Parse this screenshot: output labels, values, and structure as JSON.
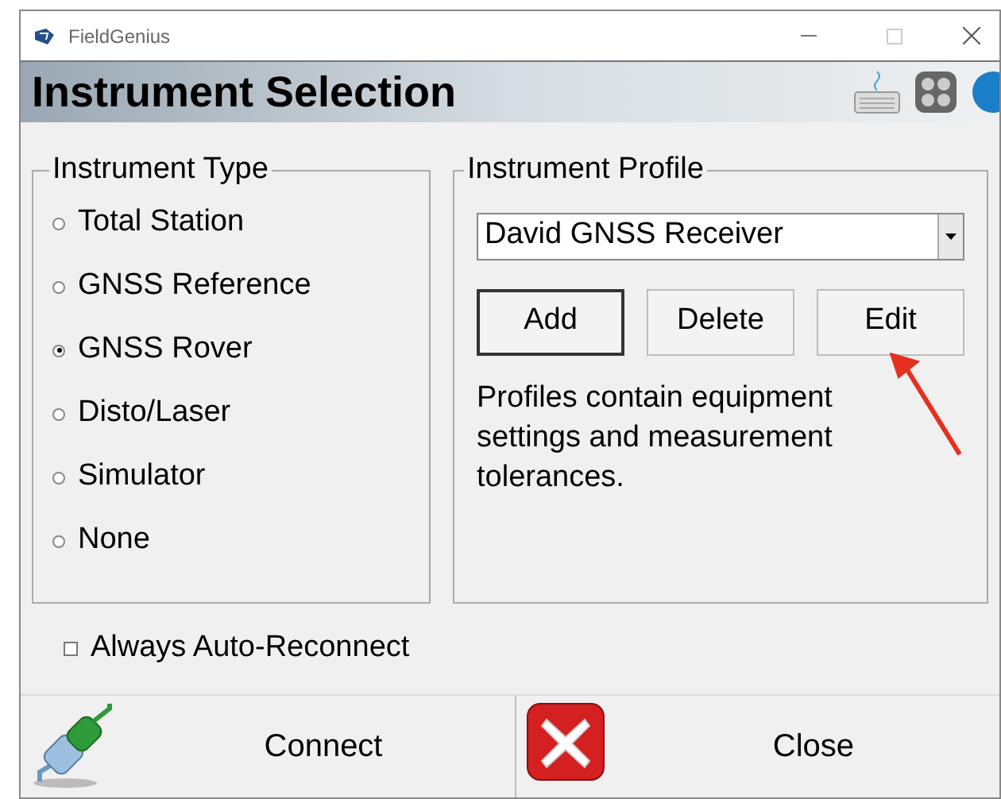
{
  "window": {
    "title": "FieldGenius"
  },
  "header": {
    "title": "Instrument Selection"
  },
  "instrument_type": {
    "title": "Instrument Type",
    "options": [
      {
        "label": "Total Station",
        "selected": false
      },
      {
        "label": "GNSS Reference",
        "selected": false
      },
      {
        "label": "GNSS Rover",
        "selected": true
      },
      {
        "label": "Disto/Laser",
        "selected": false
      },
      {
        "label": "Simulator",
        "selected": false
      },
      {
        "label": "None",
        "selected": false
      }
    ]
  },
  "instrument_profile": {
    "title": "Instrument Profile",
    "value": "David GNSS Receiver",
    "buttons": [
      "Add",
      "Delete",
      "Edit"
    ],
    "description": "Profiles contain equipment settings and measurement tolerances."
  },
  "auto_reconnect": {
    "label": "Always Auto-Reconnect",
    "checked": false
  },
  "footer_buttons": [
    {
      "kind": "connect",
      "label": "Connect"
    },
    {
      "kind": "close",
      "label": "Close"
    }
  ]
}
